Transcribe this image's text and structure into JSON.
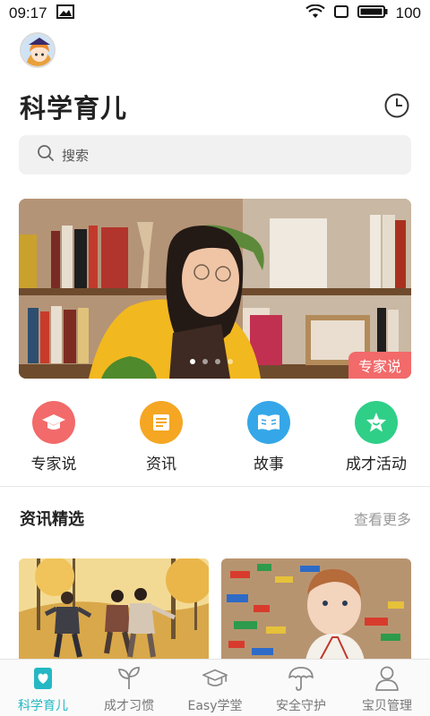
{
  "status_bar": {
    "time": "09:17",
    "battery_level": "100"
  },
  "header": {
    "title": "科学育儿"
  },
  "search": {
    "placeholder": "搜索"
  },
  "banner": {
    "tag": "专家说",
    "slide_count": 4,
    "active_slide": 1
  },
  "categories": [
    {
      "label": "专家说",
      "icon": "graduation-cap-icon",
      "color": "#f26a6a"
    },
    {
      "label": "资讯",
      "icon": "news-icon",
      "color": "#f5a623"
    },
    {
      "label": "故事",
      "icon": "book-icon",
      "color": "#35a7e8"
    },
    {
      "label": "成才活动",
      "icon": "star-icon",
      "color": "#2fcf87"
    }
  ],
  "news_section": {
    "title": "资讯精选",
    "more_label": "查看更多"
  },
  "tabbar": {
    "active_color": "#25b8c4",
    "items": [
      {
        "label": "科学育儿",
        "icon": "parenting-book-icon",
        "active": true
      },
      {
        "label": "成才习惯",
        "icon": "sprout-icon",
        "active": false
      },
      {
        "label": "Easy学堂",
        "icon": "mortarboard-icon",
        "active": false
      },
      {
        "label": "安全守护",
        "icon": "umbrella-icon",
        "active": false
      },
      {
        "label": "宝贝管理",
        "icon": "person-icon",
        "active": false
      }
    ]
  }
}
